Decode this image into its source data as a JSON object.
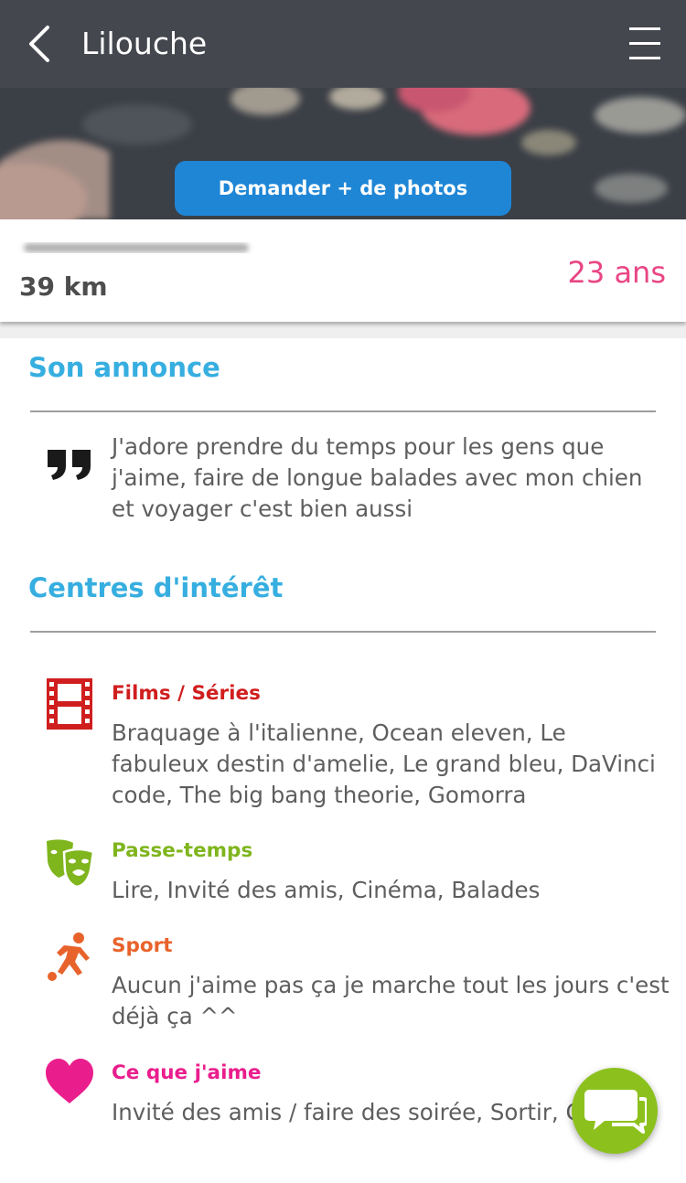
{
  "header": {
    "title": "Lilouche",
    "back_icon": "chevron-left-icon",
    "menu_icon": "hamburger-menu-icon",
    "background": "#45474f"
  },
  "photo": {
    "request_button_label": "Demander + de photos",
    "button_color": "#1f86d6"
  },
  "profile": {
    "distance": "39 km",
    "age": "23 ans",
    "age_color": "#e94584"
  },
  "sections": {
    "announcement_title": "Son annonce",
    "announcement_text": "J'adore prendre du temps pour les gens que j'aime, faire de longue balades avec mon chien et voyager c'est bien aussi",
    "interests_title": "Centres d'intérêt",
    "title_color": "#36aee0"
  },
  "interests": [
    {
      "icon": "film-strip-icon",
      "label": "Films / Séries",
      "color": "#d01e1e",
      "value": "Braquage à l'italienne, Ocean eleven, Le fabuleux destin d'amelie, Le grand bleu, DaVinci code, The big bang theorie, Gomorra"
    },
    {
      "icon": "theater-masks-icon",
      "label": "Passe-temps",
      "color": "#7fb51d",
      "value": "Lire, Invité des amis, Cinéma, Balades"
    },
    {
      "icon": "soccer-player-icon",
      "label": "Sport",
      "color": "#e8632b",
      "value": "Aucun j'aime pas ça je marche tout les jours c'est déjà ça ^^"
    },
    {
      "icon": "heart-icon",
      "label": "Ce que j'aime",
      "color": "#ea1d8c",
      "value": "Invité des amis / faire des soirée, Sortir, Cuisiner"
    }
  ],
  "chat": {
    "icon": "chat-bubbles-icon",
    "color": "#8cc11d"
  }
}
